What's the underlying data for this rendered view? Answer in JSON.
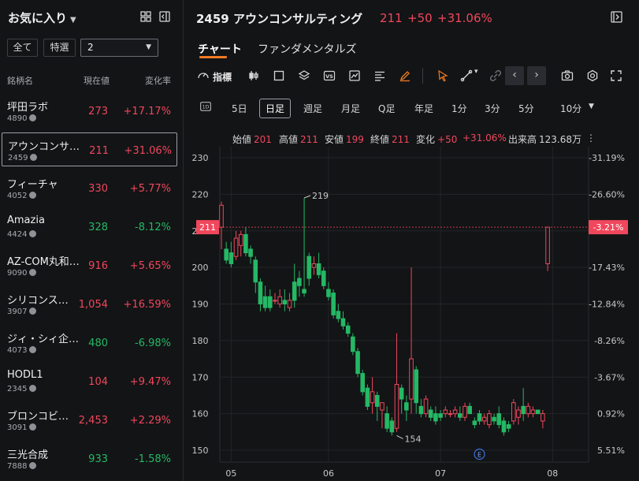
{
  "watchlist": {
    "title": "お気に入り",
    "filters": [
      "全て",
      "特選"
    ],
    "group_value": "2",
    "columns": {
      "name": "銘柄名",
      "price": "現在値",
      "change": "変化率"
    },
    "items": [
      {
        "name": "坪田ラボ",
        "code": "4890",
        "price": "273",
        "change": "+17.17%",
        "dir": "up"
      },
      {
        "name": "アウンコンサ…",
        "code": "2459",
        "price": "211",
        "change": "+31.06%",
        "dir": "up",
        "selected": true
      },
      {
        "name": "フィーチャ",
        "code": "4052",
        "price": "330",
        "change": "+5.77%",
        "dir": "up"
      },
      {
        "name": "Amazia",
        "code": "4424",
        "price": "328",
        "change": "-8.12%",
        "dir": "dn"
      },
      {
        "name": "AZ-COM丸和…",
        "code": "9090",
        "price": "916",
        "change": "+5.65%",
        "dir": "up"
      },
      {
        "name": "シリコンス…",
        "code": "3907",
        "price": "1,054",
        "change": "+16.59%",
        "dir": "up"
      },
      {
        "name": "ジィ・シィ企…",
        "code": "4073",
        "price": "480",
        "change": "-6.98%",
        "dir": "dn"
      },
      {
        "name": "HODL1",
        "code": "2345",
        "price": "104",
        "change": "+9.47%",
        "dir": "up"
      },
      {
        "name": "ブロンコビ…",
        "code": "3091",
        "price": "2,453",
        "change": "+2.29%",
        "dir": "up"
      },
      {
        "name": "三光合成",
        "code": "7888",
        "price": "933",
        "change": "-1.58%",
        "dir": "dn"
      }
    ]
  },
  "header": {
    "title": "2459 アウンコンサルティング",
    "price": "211",
    "change": "+50",
    "change_pct": "+31.06%"
  },
  "tabs": [
    "チャート",
    "ファンダメンタルズ"
  ],
  "toolbar": {
    "indicator_label": "指標"
  },
  "periods": [
    "5日",
    "日足",
    "週足",
    "月足",
    "Q足",
    "年足",
    "1分",
    "3分",
    "5分",
    "10分"
  ],
  "active_period": "日足",
  "ohlc": [
    {
      "k": "始値",
      "v": "201"
    },
    {
      "k": "高値",
      "v": "211"
    },
    {
      "k": "安値",
      "v": "199"
    },
    {
      "k": "終値",
      "v": "211"
    },
    {
      "k": "変化",
      "v": "+50"
    },
    {
      "k": "",
      "v": "+31.06%"
    },
    {
      "k": "出来高",
      "v": "123.68万"
    }
  ],
  "colors": {
    "up": "#f0475c",
    "down": "#25b865",
    "accent": "#f07a21"
  },
  "chart_data": {
    "type": "candlestick",
    "ylim": [
      148,
      233
    ],
    "y_ticks": [
      150,
      160,
      170,
      180,
      190,
      200,
      210,
      220,
      230
    ],
    "pct_ticks": [
      "5.51%",
      "0.92%",
      "-3.67%",
      "-8.26%",
      "-12.84%",
      "-17.43%",
      "-22.02%",
      "-26.60%",
      "-31.19%"
    ],
    "x_ticks": [
      {
        "label": "05",
        "i": 2
      },
      {
        "label": "06",
        "i": 22
      },
      {
        "label": "07",
        "i": 45
      },
      {
        "label": "08",
        "i": 68
      }
    ],
    "last_price_label": "211",
    "last_pct_label": "-3.21%",
    "annotations": [
      {
        "label": "219",
        "i": 17,
        "v": 219
      },
      {
        "label": "154",
        "i": 36,
        "v": 154
      }
    ],
    "event_marker": {
      "label": "E",
      "i": 53
    },
    "candles": [
      {
        "o": 211,
        "h": 218,
        "l": 205,
        "c": 217
      },
      {
        "o": 205,
        "h": 207,
        "l": 201,
        "c": 202
      },
      {
        "o": 204,
        "h": 207,
        "l": 200,
        "c": 201
      },
      {
        "o": 203,
        "h": 210,
        "l": 202,
        "c": 208
      },
      {
        "o": 206,
        "h": 210,
        "l": 203,
        "c": 209
      },
      {
        "o": 209,
        "h": 211,
        "l": 203,
        "c": 204
      },
      {
        "o": 205,
        "h": 206,
        "l": 201,
        "c": 203
      },
      {
        "o": 202,
        "h": 203,
        "l": 193,
        "c": 196
      },
      {
        "o": 196,
        "h": 197,
        "l": 188,
        "c": 190
      },
      {
        "o": 192,
        "h": 195,
        "l": 188,
        "c": 189
      },
      {
        "o": 192,
        "h": 194,
        "l": 188,
        "c": 189
      },
      {
        "o": 191,
        "h": 193,
        "l": 190,
        "c": 191
      },
      {
        "o": 190,
        "h": 194,
        "l": 189,
        "c": 192
      },
      {
        "o": 191,
        "h": 194,
        "l": 188,
        "c": 190
      },
      {
        "o": 189,
        "h": 193,
        "l": 188,
        "c": 191
      },
      {
        "o": 196,
        "h": 201,
        "l": 189,
        "c": 191
      },
      {
        "o": 197,
        "h": 199,
        "l": 192,
        "c": 195
      },
      {
        "o": 194,
        "h": 219,
        "l": 192,
        "c": 193
      },
      {
        "o": 203,
        "h": 204,
        "l": 195,
        "c": 197
      },
      {
        "o": 200,
        "h": 203,
        "l": 198,
        "c": 201
      },
      {
        "o": 201,
        "h": 204,
        "l": 197,
        "c": 198
      },
      {
        "o": 199,
        "h": 200,
        "l": 194,
        "c": 195
      },
      {
        "o": 194,
        "h": 196,
        "l": 191,
        "c": 192
      },
      {
        "o": 193,
        "h": 194,
        "l": 186,
        "c": 187
      },
      {
        "o": 188,
        "h": 190,
        "l": 185,
        "c": 186
      },
      {
        "o": 186,
        "h": 188,
        "l": 183,
        "c": 184
      },
      {
        "o": 184,
        "h": 185,
        "l": 181,
        "c": 182
      },
      {
        "o": 181,
        "h": 182,
        "l": 176,
        "c": 177
      },
      {
        "o": 177,
        "h": 178,
        "l": 170,
        "c": 171
      },
      {
        "o": 171,
        "h": 172,
        "l": 165,
        "c": 166
      },
      {
        "o": 167,
        "h": 168,
        "l": 161,
        "c": 162
      },
      {
        "o": 163,
        "h": 170,
        "l": 160,
        "c": 166
      },
      {
        "o": 165,
        "h": 166,
        "l": 158,
        "c": 162
      },
      {
        "o": 161,
        "h": 162,
        "l": 156,
        "c": 163
      },
      {
        "o": 160,
        "h": 162,
        "l": 155,
        "c": 156
      },
      {
        "o": 158,
        "h": 159,
        "l": 154,
        "c": 155
      },
      {
        "o": 156,
        "h": 182,
        "l": 155,
        "c": 168
      },
      {
        "o": 167,
        "h": 168,
        "l": 160,
        "c": 164
      },
      {
        "o": 163,
        "h": 165,
        "l": 158,
        "c": 161
      },
      {
        "o": 164,
        "h": 200,
        "l": 160,
        "c": 175
      },
      {
        "o": 172,
        "h": 173,
        "l": 160,
        "c": 163
      },
      {
        "o": 162,
        "h": 164,
        "l": 159,
        "c": 160
      },
      {
        "o": 160,
        "h": 165,
        "l": 159,
        "c": 164
      },
      {
        "o": 161,
        "h": 162,
        "l": 158,
        "c": 159
      },
      {
        "o": 160,
        "h": 162,
        "l": 157,
        "c": 158
      },
      {
        "o": 160,
        "h": 161,
        "l": 158,
        "c": 159
      },
      {
        "o": 160,
        "h": 162,
        "l": 159,
        "c": 161
      },
      {
        "o": 160,
        "h": 161,
        "l": 159,
        "c": 160
      },
      {
        "o": 160,
        "h": 162,
        "l": 159,
        "c": 161
      },
      {
        "o": 160,
        "h": 162,
        "l": 158,
        "c": 159
      },
      {
        "o": 159,
        "h": 163,
        "l": 158,
        "c": 162
      },
      {
        "o": 162,
        "h": 163,
        "l": 160,
        "c": 160
      },
      {
        "o": 158,
        "h": 159,
        "l": 156,
        "c": 157
      },
      {
        "o": 160,
        "h": 161,
        "l": 157,
        "c": 158
      },
      {
        "o": 158,
        "h": 160,
        "l": 157,
        "c": 159
      },
      {
        "o": 157,
        "h": 161,
        "l": 156,
        "c": 160
      },
      {
        "o": 159,
        "h": 160,
        "l": 157,
        "c": 158
      },
      {
        "o": 160,
        "h": 162,
        "l": 156,
        "c": 157
      },
      {
        "o": 158,
        "h": 159,
        "l": 154,
        "c": 155
      },
      {
        "o": 157,
        "h": 158,
        "l": 155,
        "c": 156
      },
      {
        "o": 158,
        "h": 164,
        "l": 157,
        "c": 163
      },
      {
        "o": 159,
        "h": 162,
        "l": 157,
        "c": 161
      },
      {
        "o": 162,
        "h": 167,
        "l": 158,
        "c": 160
      },
      {
        "o": 160,
        "h": 163,
        "l": 159,
        "c": 162
      },
      {
        "o": 160,
        "h": 162,
        "l": 159,
        "c": 161
      },
      {
        "o": 161,
        "h": 161,
        "l": 160,
        "c": 160
      },
      {
        "o": 158,
        "h": 161,
        "l": 156,
        "c": 160
      },
      {
        "o": 201,
        "h": 211,
        "l": 199,
        "c": 211
      }
    ]
  }
}
